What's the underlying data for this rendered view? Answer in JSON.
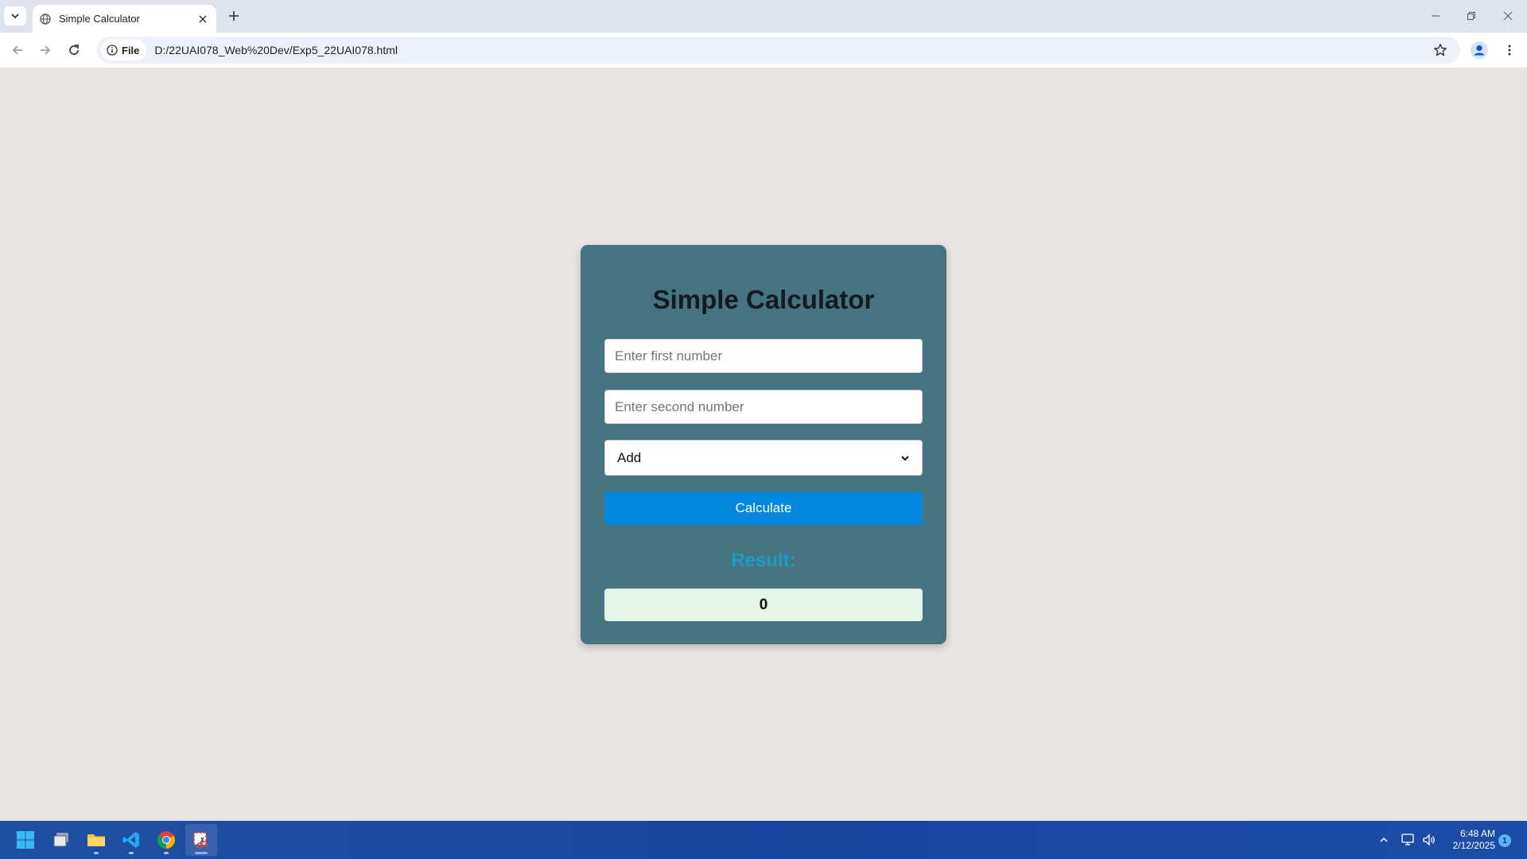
{
  "browser": {
    "tab_title": "Simple Calculator",
    "address_chip": "File",
    "url": "D:/22UAI078_Web%20Dev/Exp5_22UAI078.html"
  },
  "calculator": {
    "title": "Simple Calculator",
    "first_placeholder": "Enter first number",
    "second_placeholder": "Enter second number",
    "operation_selected": "Add",
    "calculate_label": "Calculate",
    "result_label": "Result:",
    "result_value": "0"
  },
  "taskbar": {
    "apps": [
      "start-icon",
      "task-view-icon",
      "file-explorer-icon",
      "vscode-icon",
      "chrome-icon",
      "snipping-tool-icon"
    ],
    "time": "6:48 AM",
    "date": "2/12/2025",
    "notification_count": "1"
  },
  "colors": {
    "page_background": "#e8e4e4",
    "card_background": "#457380",
    "button_blue": "#0287dc",
    "result_label": "#1c9bc3",
    "result_box": "#e3f5e6",
    "taskbar": "#1f4fa3"
  }
}
